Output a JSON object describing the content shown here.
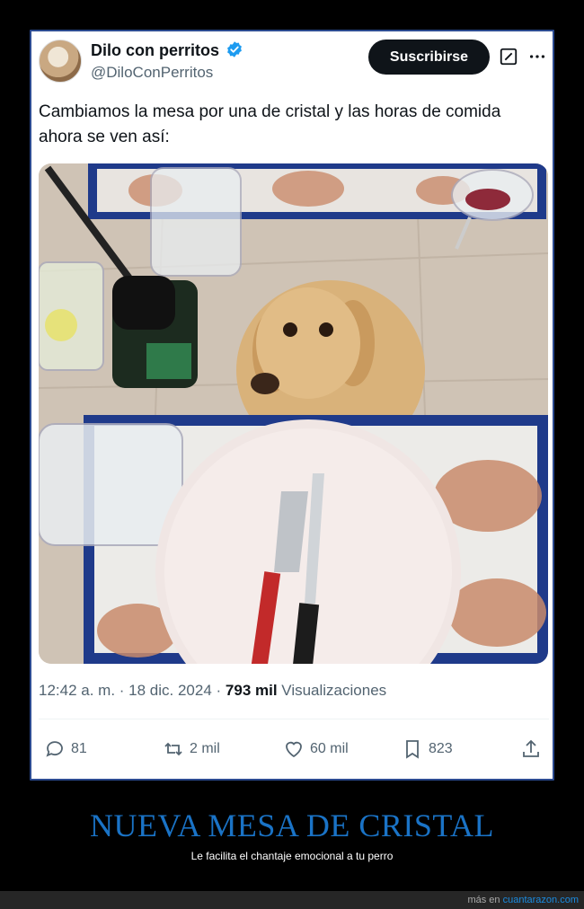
{
  "tweet": {
    "author_name": "Dilo con perritos",
    "handle": "@DiloConPerritos",
    "subscribe_label": "Suscribirse",
    "text": "Cambiamos la mesa por una de cristal y las horas de comida ahora se ven así:",
    "time": "12:42 a. m. · 18 dic. 2024 · ",
    "views_count": "793 mil",
    "views_label": " Visualizaciones",
    "replies": "81",
    "reposts": "2 mil",
    "likes": "60 mil",
    "bookmarks": "823",
    "icons": [
      "verified-badge-icon",
      "grok-icon",
      "more-icon",
      "reply-icon",
      "repost-icon",
      "like-icon",
      "bookmark-icon",
      "share-icon"
    ]
  },
  "caption": {
    "title": "NUEVA MESA DE CRISTAL",
    "subtitle": "Le facilita el chantaje emocional a tu perro"
  },
  "footer": {
    "prefix": "más en ",
    "link": "cuantarazon.com"
  },
  "colors": {
    "background": "#000000",
    "card_border": "#2b4a8f",
    "verified": "#1d9bf0",
    "caption_title": "#1a73c6",
    "footer_link": "#1a8be0"
  }
}
